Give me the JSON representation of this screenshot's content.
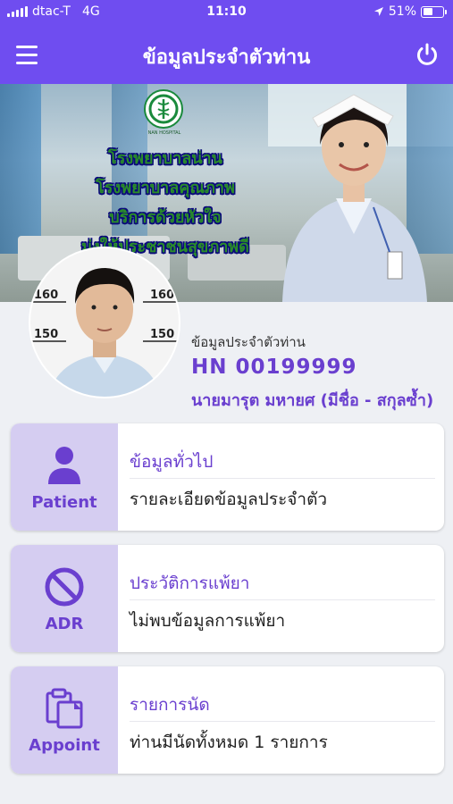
{
  "status_bar": {
    "carrier": "dtac-T",
    "network": "4G",
    "time": "11:10",
    "battery": "51%",
    "battery_level": 0.51
  },
  "nav": {
    "title": "ข้อมูลประจำตัวท่าน",
    "menu_icon": "hamburger-icon",
    "power_icon": "power-icon"
  },
  "banner": {
    "tagline": [
      "โรงพยาบาลน่าน",
      "โรงพยาบาลคุณภาพ",
      "บริการด้วยหัวใจ",
      "มุ่งให้ประชาชนสุขภาพดี"
    ],
    "logo_text": "NAN HOSPITAL"
  },
  "profile": {
    "label": "ข้อมูลประจำตัวท่าน",
    "hn": "HN  00199999",
    "name": "นายมารุต  มหายศ (มีชื่อ - สกุลซ้ำ)"
  },
  "cards": [
    {
      "side_label": "Patient",
      "icon": "person-icon",
      "title": "ข้อมูลทั่วไป",
      "desc": "รายละเอียดข้อมูลประจำตัว"
    },
    {
      "side_label": "ADR",
      "icon": "no-entry-icon",
      "title": "ประวัติการแพ้ยา",
      "desc": "ไม่พบข้อมูลการแพ้ยา"
    },
    {
      "side_label": "Appoint",
      "icon": "clipboard-icon",
      "title": "รายการนัด",
      "desc": "ท่านมีนัดทั้งหมด 1 รายการ"
    }
  ],
  "colors": {
    "primary": "#6f4df0",
    "accent_text": "#6a3fcf",
    "card_side": "#d5cdf1",
    "background": "#eef0f4"
  }
}
